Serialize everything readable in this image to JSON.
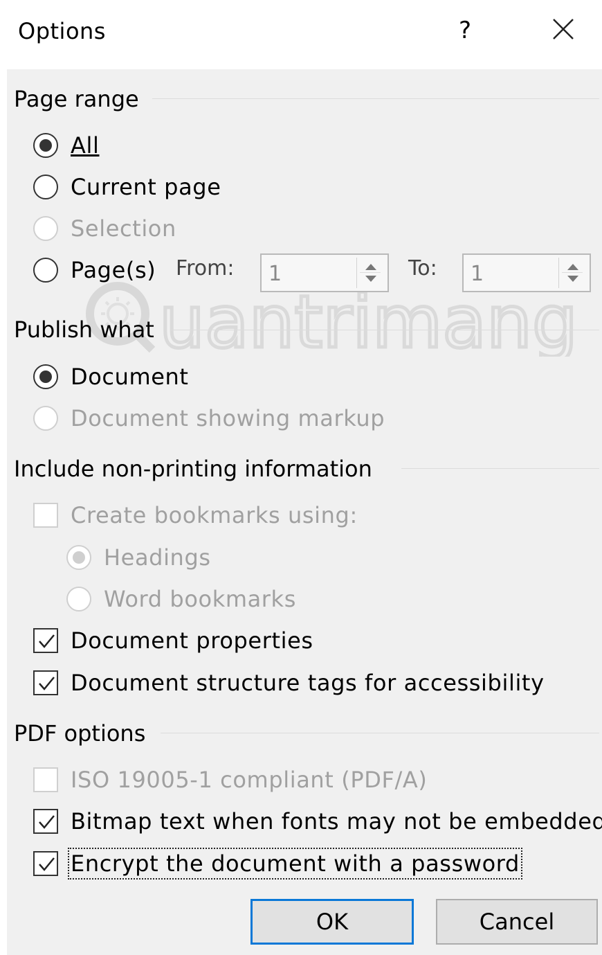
{
  "window": {
    "title": "Options",
    "help_label": "?"
  },
  "page_range": {
    "heading": "Page range",
    "options": [
      {
        "label": "All",
        "checked": true,
        "enabled": true
      },
      {
        "label": "Current page",
        "checked": false,
        "enabled": true
      },
      {
        "label": "Selection",
        "checked": false,
        "enabled": false
      },
      {
        "label": "Page(s)",
        "checked": false,
        "enabled": true
      }
    ],
    "from_label": "From:",
    "from_value": "1",
    "to_label": "To:",
    "to_value": "1"
  },
  "publish_what": {
    "heading": "Publish what",
    "options": [
      {
        "label": "Document",
        "checked": true,
        "enabled": true
      },
      {
        "label": "Document showing markup",
        "checked": false,
        "enabled": false
      }
    ]
  },
  "non_printing": {
    "heading": "Include non-printing information",
    "create_bookmarks": {
      "label": "Create bookmarks using:",
      "checked": false,
      "enabled": false
    },
    "bookmark_options": [
      {
        "label": "Headings",
        "checked": true,
        "enabled": false
      },
      {
        "label": "Word bookmarks",
        "checked": false,
        "enabled": false
      }
    ],
    "document_properties": {
      "label": "Document properties",
      "checked": true
    },
    "structure_tags": {
      "label": "Document structure tags for accessibility",
      "checked": true
    }
  },
  "pdf_options": {
    "heading": "PDF options",
    "iso": {
      "label": "ISO 19005-1 compliant (PDF/A)",
      "checked": false,
      "enabled": false
    },
    "bitmap_text": {
      "label": "Bitmap text when fonts may not be embedded",
      "checked": true
    },
    "encrypt": {
      "label": "Encrypt the document with a password",
      "checked": true
    }
  },
  "buttons": {
    "ok": "OK",
    "cancel": "Cancel"
  },
  "watermark": {
    "text": "uantrimang"
  }
}
